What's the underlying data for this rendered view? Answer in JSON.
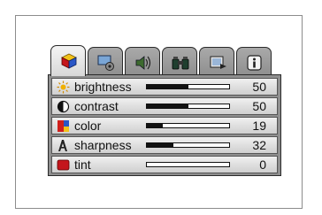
{
  "tabs": [
    {
      "icon": "picture-icon",
      "active": true
    },
    {
      "icon": "setup-icon",
      "active": false
    },
    {
      "icon": "audio-icon",
      "active": false
    },
    {
      "icon": "zoom-icon",
      "active": false
    },
    {
      "icon": "input-icon",
      "active": false
    },
    {
      "icon": "info-icon",
      "active": false
    }
  ],
  "rows": [
    {
      "icon": "brightness-icon",
      "label": "brightness",
      "value": "50",
      "level": 0.5
    },
    {
      "icon": "contrast-icon",
      "label": "contrast",
      "value": "50",
      "level": 0.5
    },
    {
      "icon": "color-icon",
      "label": "color",
      "value": "19",
      "level": 0.19
    },
    {
      "icon": "sharpness-icon",
      "label": "sharpness",
      "value": "32",
      "level": 0.32
    },
    {
      "icon": "tint-icon",
      "label": "tint",
      "value": "0",
      "level": 0.0
    }
  ]
}
